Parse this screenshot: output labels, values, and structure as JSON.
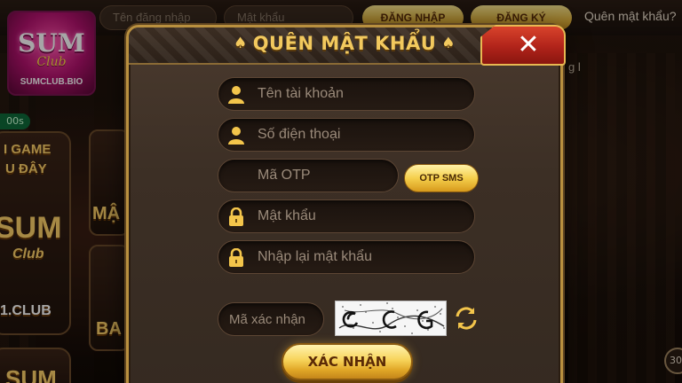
{
  "topbar": {
    "username_placeholder": "Tên đăng nhập",
    "password_placeholder": "Mật khẩu",
    "login_label": "ĐĂNG NHẬP",
    "register_label": "ĐĂNG KÝ",
    "forgot_link": "Quên mật khẩu?"
  },
  "logo": {
    "name": "SUM",
    "club": "Club",
    "domain": "SUMCLUB.BIO"
  },
  "background": {
    "timer": "00s",
    "card_game_text": "I GAME",
    "card_here_text": "U ĐÂY",
    "card_sum_text": "SUM",
    "card_club_text": "Club",
    "card_domain_text": "1.CLUB",
    "card_ma_text": "MẬ",
    "card_ba_text": "BA",
    "card_bottom_text": "SUM",
    "edge_text": "g l",
    "edge_badge": "30"
  },
  "dialog": {
    "title": "QUÊN MẬT KHẨU",
    "close_label": "✕",
    "fields": {
      "username_placeholder": "Tên tài khoản",
      "phone_placeholder": "Số điện thoại",
      "otp_placeholder": "Mã OTP",
      "password_placeholder": "Mật khẩu",
      "password_confirm_placeholder": "Nhập lại mật khẩu",
      "captcha_placeholder": "Mã xác nhận"
    },
    "otp_button": "OTP SMS",
    "confirm_button": "XÁC NHẬN"
  },
  "colors": {
    "accent_gold": "#f2c95e",
    "close_red": "#b0231a",
    "field_bg": "#1a120d"
  },
  "icons": {
    "user": "user-icon",
    "lock": "lock-icon",
    "refresh": "refresh-icon",
    "close": "close-icon",
    "spade": "spade-icon"
  }
}
